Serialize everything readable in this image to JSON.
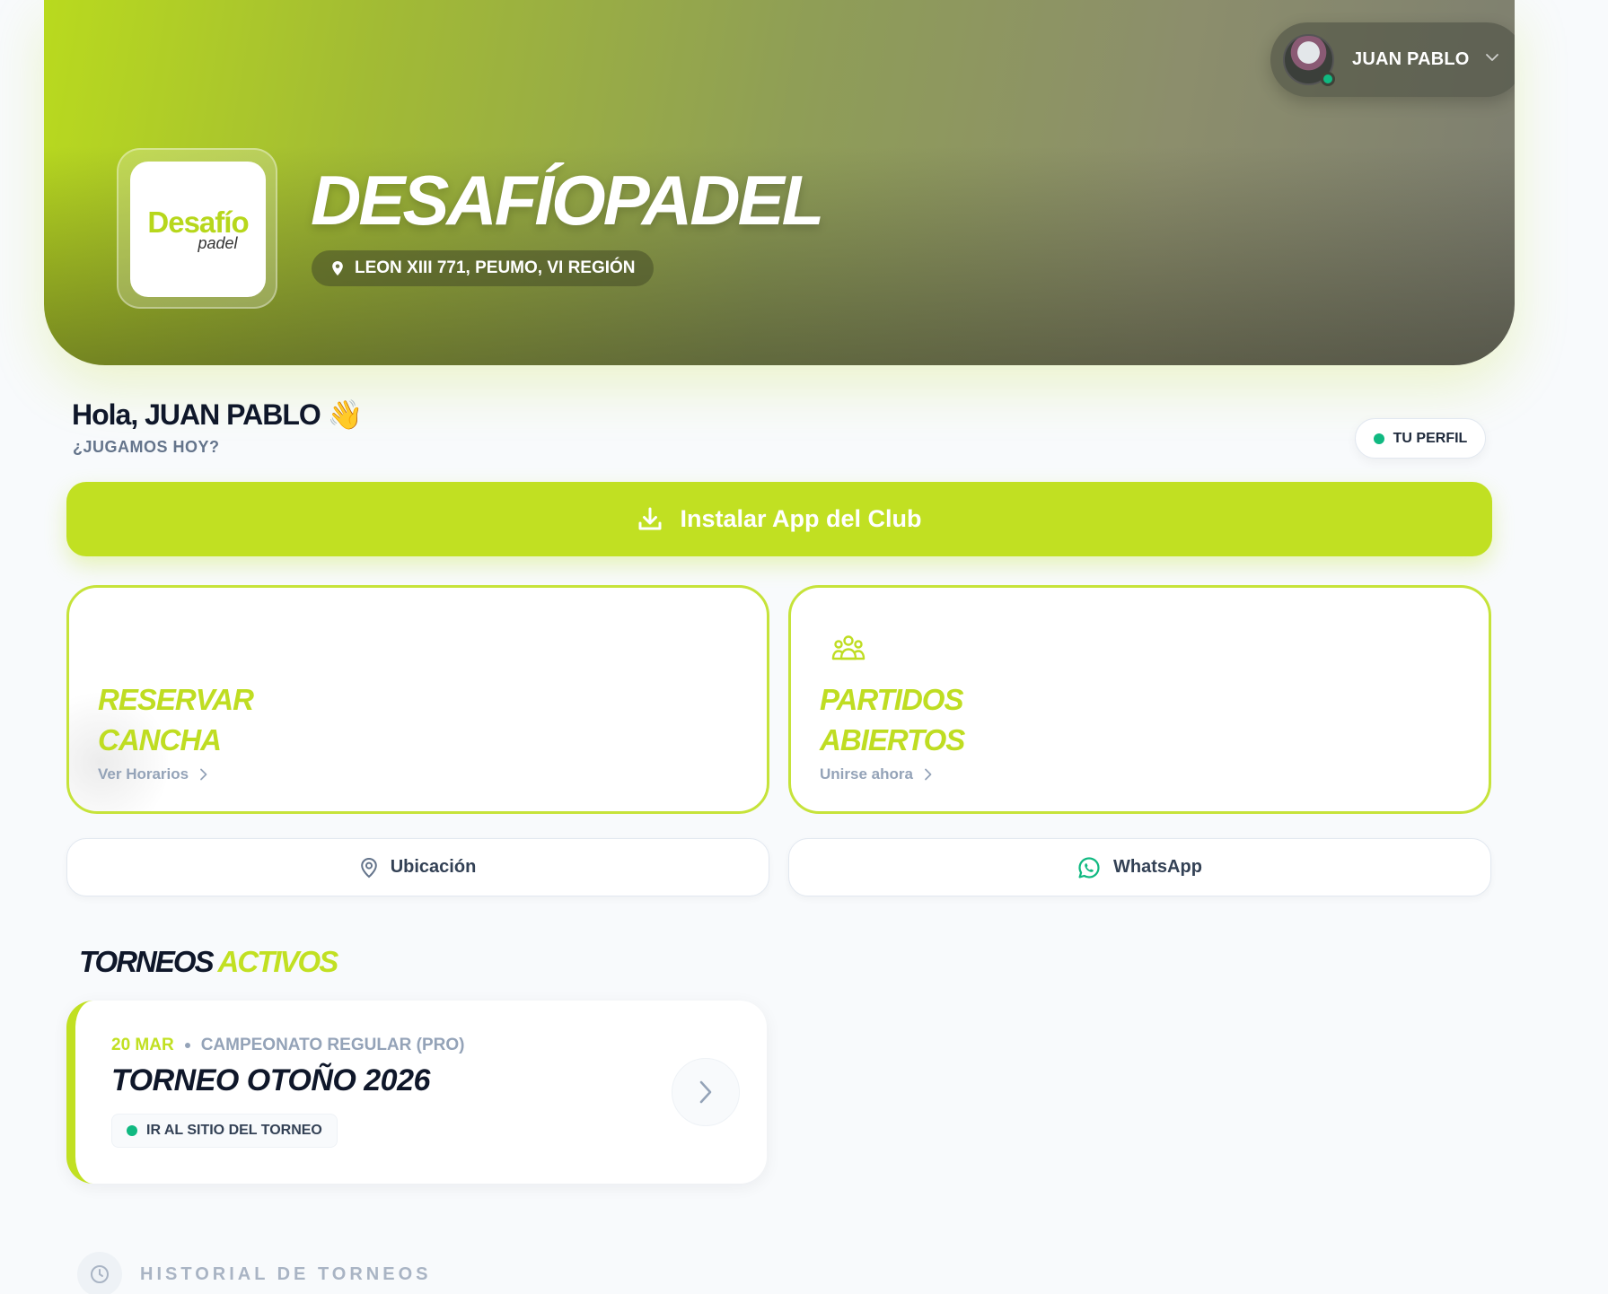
{
  "user": {
    "name": "JUAN PABLO"
  },
  "club": {
    "logo_word": "Desafío",
    "logo_sub": "padel",
    "title": "DESAFÍOPADEL",
    "address": "LEON XIII 771, PEUMO, VI REGIÓN"
  },
  "greeting": {
    "text": "Hola, JUAN PABLO 👋",
    "subtitle": "¿JUGAMOS HOY?",
    "profile_label": "TU PERFIL"
  },
  "install": {
    "label": "Instalar App del Club"
  },
  "actions": {
    "reserve": {
      "title_line1": "RESERVAR",
      "title_line2": "CANCHA",
      "link": "Ver Horarios"
    },
    "matches": {
      "title_line1": "PARTIDOS",
      "title_line2": "ABIERTOS",
      "link": "Unirse ahora"
    }
  },
  "secondary": {
    "location": "Ubicación",
    "whatsapp": "WhatsApp"
  },
  "tournaments": {
    "title_dark": "TORNEOS",
    "title_accent": "ACTIVOS",
    "items": [
      {
        "date": "20 MAR",
        "category": "CAMPEONATO REGULAR (PRO)",
        "name": "TORNEO OTOÑO 2026",
        "chip": "IR AL SITIO DEL TORNEO"
      }
    ]
  },
  "history": {
    "label": "HISTORIAL DE TORNEOS"
  },
  "colors": {
    "accent": "#c1e022",
    "status_green": "#10b981",
    "text_dark": "#0f172a",
    "muted": "#94a3b8"
  },
  "icons": {
    "location": "map-pin-icon",
    "download": "download-icon",
    "group": "users-group-icon",
    "whatsapp": "whatsapp-icon",
    "clock": "clock-icon",
    "chevron": "chevron-right-icon"
  }
}
